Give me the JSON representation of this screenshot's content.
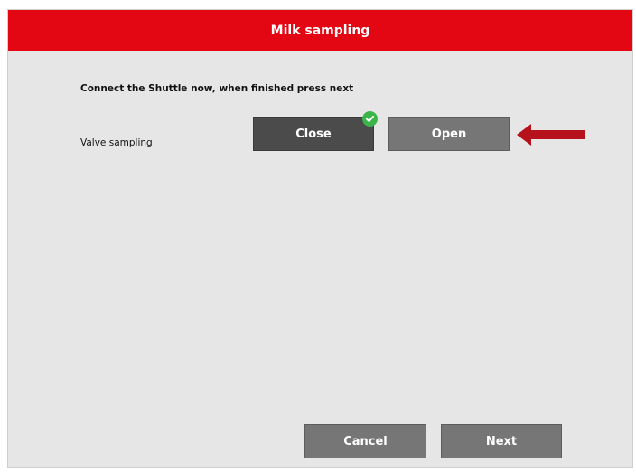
{
  "window": {
    "title": "Milk sampling"
  },
  "content": {
    "instruction": "Connect the Shuttle now, when finished press next",
    "valve_row": {
      "label": "Valve sampling",
      "close_label": "Close",
      "open_label": "Open",
      "selected": "Close"
    }
  },
  "footer": {
    "cancel_label": "Cancel",
    "next_label": "Next"
  },
  "colors": {
    "titlebar": "#e30613",
    "background": "#e6e6e6",
    "selected_button": "#4b4b4b",
    "button": "#767676",
    "check_badge": "#3bb54a",
    "annotation_arrow": "#b5121b"
  },
  "icons": {
    "check_badge": "check-circle-icon",
    "annotation": "arrow-left-icon"
  }
}
